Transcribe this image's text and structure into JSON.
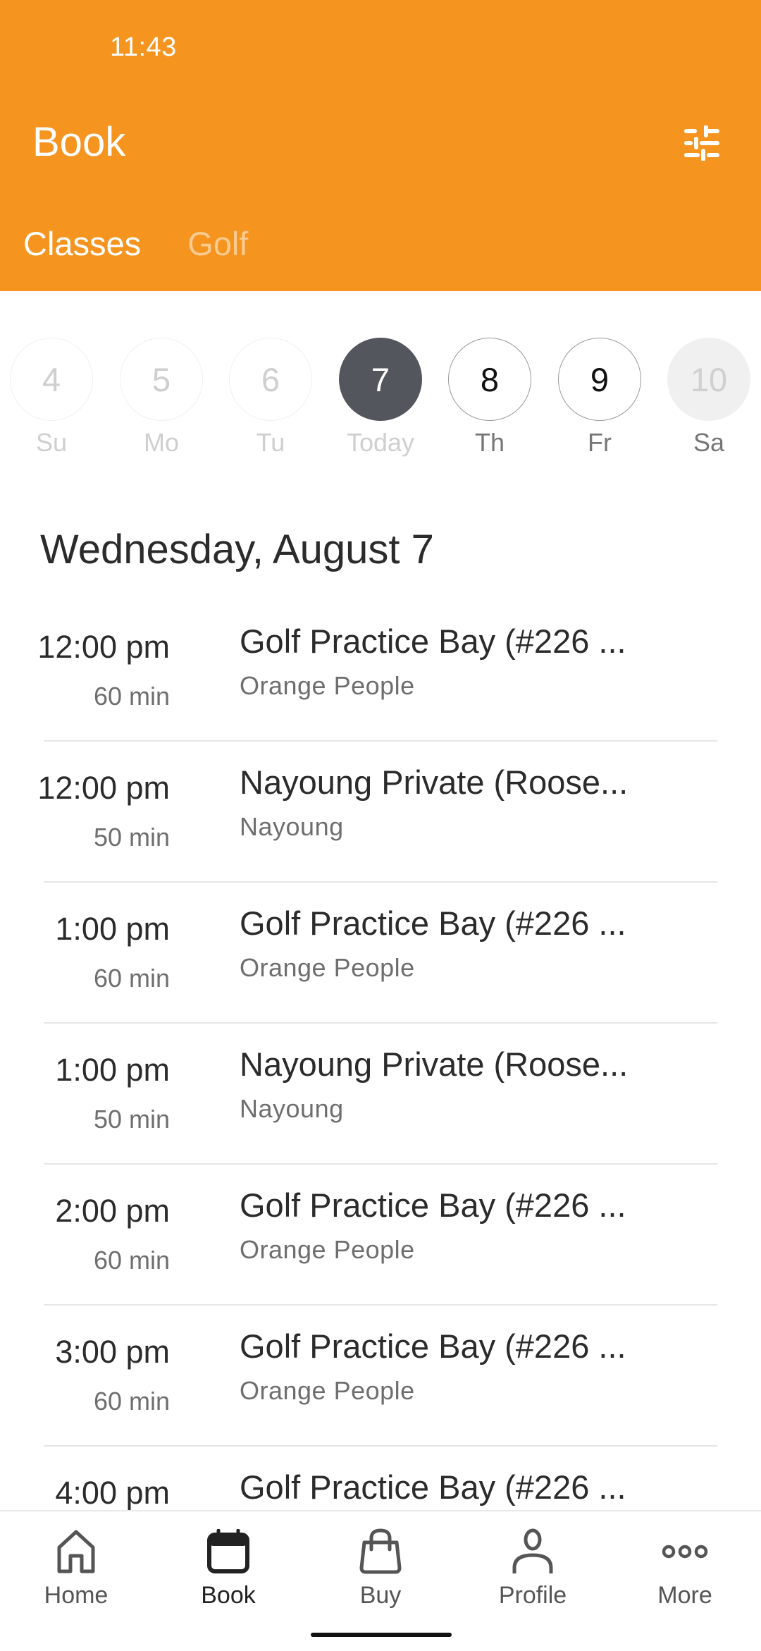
{
  "status_bar": {
    "time": "11:43"
  },
  "header": {
    "title": "Book",
    "filter_icon": "sliders-icon",
    "tabs": [
      {
        "label": "Classes",
        "active": true
      },
      {
        "label": "Golf",
        "active": false
      }
    ]
  },
  "colors": {
    "brand": "#F5941F",
    "today_circle": "#53565c",
    "divider": "#e6e6e6"
  },
  "date_strip": {
    "days": [
      {
        "number": "4",
        "label": "Su",
        "state": "past"
      },
      {
        "number": "5",
        "label": "Mo",
        "state": "past"
      },
      {
        "number": "6",
        "label": "Tu",
        "state": "past"
      },
      {
        "number": "7",
        "label": "Today",
        "state": "today"
      },
      {
        "number": "8",
        "label": "Th",
        "state": "future"
      },
      {
        "number": "9",
        "label": "Fr",
        "state": "future"
      },
      {
        "number": "10",
        "label": "Sa",
        "state": "disabled"
      }
    ]
  },
  "schedule": {
    "date_heading": "Wednesday, August 7",
    "items": [
      {
        "time": "12:00 pm",
        "duration": "60 min",
        "name": "Golf Practice Bay (#226 ...",
        "instructor": "Orange People"
      },
      {
        "time": "12:00 pm",
        "duration": "50 min",
        "name": "Nayoung Private (Roose...",
        "instructor": "Nayoung"
      },
      {
        "time": "1:00 pm",
        "duration": "60 min",
        "name": "Golf Practice Bay (#226 ...",
        "instructor": "Orange People"
      },
      {
        "time": "1:00 pm",
        "duration": "50 min",
        "name": "Nayoung Private (Roose...",
        "instructor": "Nayoung"
      },
      {
        "time": "2:00 pm",
        "duration": "60 min",
        "name": "Golf Practice Bay (#226 ...",
        "instructor": "Orange People"
      },
      {
        "time": "3:00 pm",
        "duration": "60 min",
        "name": "Golf Practice Bay (#226 ...",
        "instructor": "Orange People"
      },
      {
        "time": "4:00 pm",
        "duration": "",
        "name": "Golf Practice Bay (#226 ...",
        "instructor": ""
      }
    ]
  },
  "bottom_nav": {
    "items": [
      {
        "label": "Home",
        "icon": "home-icon",
        "active": false
      },
      {
        "label": "Book",
        "icon": "calendar-icon",
        "active": true
      },
      {
        "label": "Buy",
        "icon": "shopping-bag-icon",
        "active": false
      },
      {
        "label": "Profile",
        "icon": "person-icon",
        "active": false
      },
      {
        "label": "More",
        "icon": "more-dots-icon",
        "active": false
      }
    ]
  }
}
